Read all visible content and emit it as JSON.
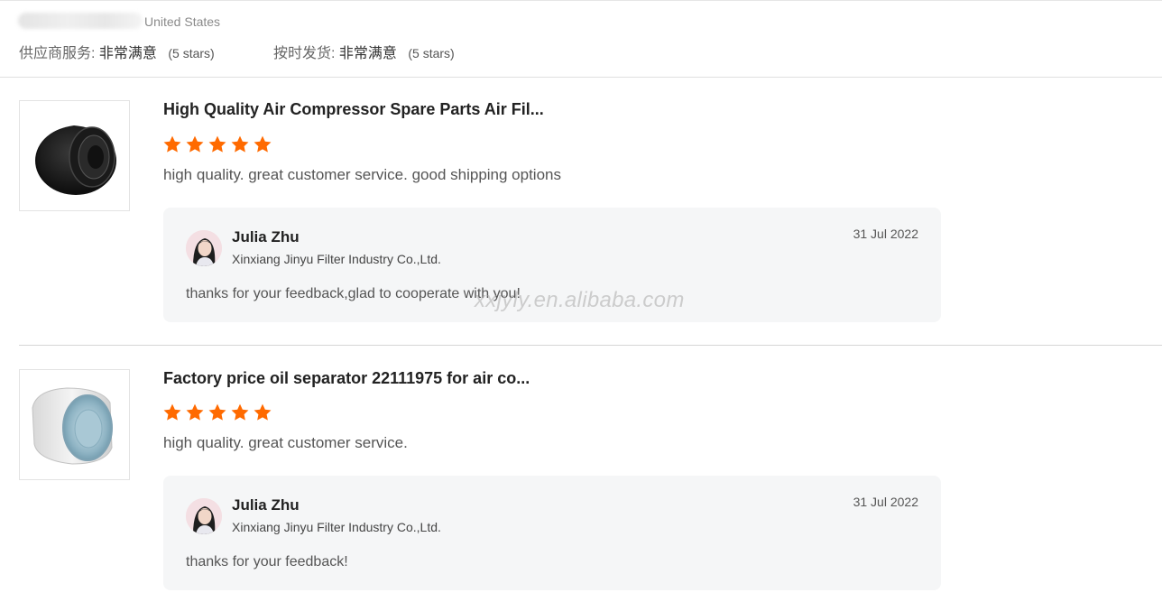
{
  "reviewer": {
    "country": "United States"
  },
  "ratings": [
    {
      "label": "供应商服务:",
      "value": "非常满意",
      "stars_text": "(5 stars)"
    },
    {
      "label": "按时发货:",
      "value": "非常满意",
      "stars_text": "(5 stars)"
    }
  ],
  "reviews": [
    {
      "product_title": "High Quality Air Compressor Spare Parts Air Fil...",
      "star_rating": 5,
      "review_text": "high quality. great customer service. good shipping options",
      "reply": {
        "name": "Julia Zhu",
        "company": "Xinxiang Jinyu Filter Industry Co.,Ltd.",
        "date": "31 Jul 2022",
        "text": "thanks for your feedback,glad to cooperate with you!"
      }
    },
    {
      "product_title": "Factory price oil separator 22111975 for air co...",
      "star_rating": 5,
      "review_text": "high quality. great customer service.",
      "reply": {
        "name": "Julia Zhu",
        "company": "Xinxiang Jinyu Filter Industry Co.,Ltd.",
        "date": "31 Jul 2022",
        "text": "thanks for your feedback!"
      }
    }
  ],
  "watermark": "xxjyly.en.alibaba.com",
  "colors": {
    "star": "#ff6a00",
    "reply_bg": "#f5f6f7",
    "divider": "#e0e0e0"
  },
  "icons": {
    "star": "star-icon",
    "avatar": "avatar",
    "product_image_1": "air-filter-image",
    "product_image_2": "oil-separator-image"
  }
}
